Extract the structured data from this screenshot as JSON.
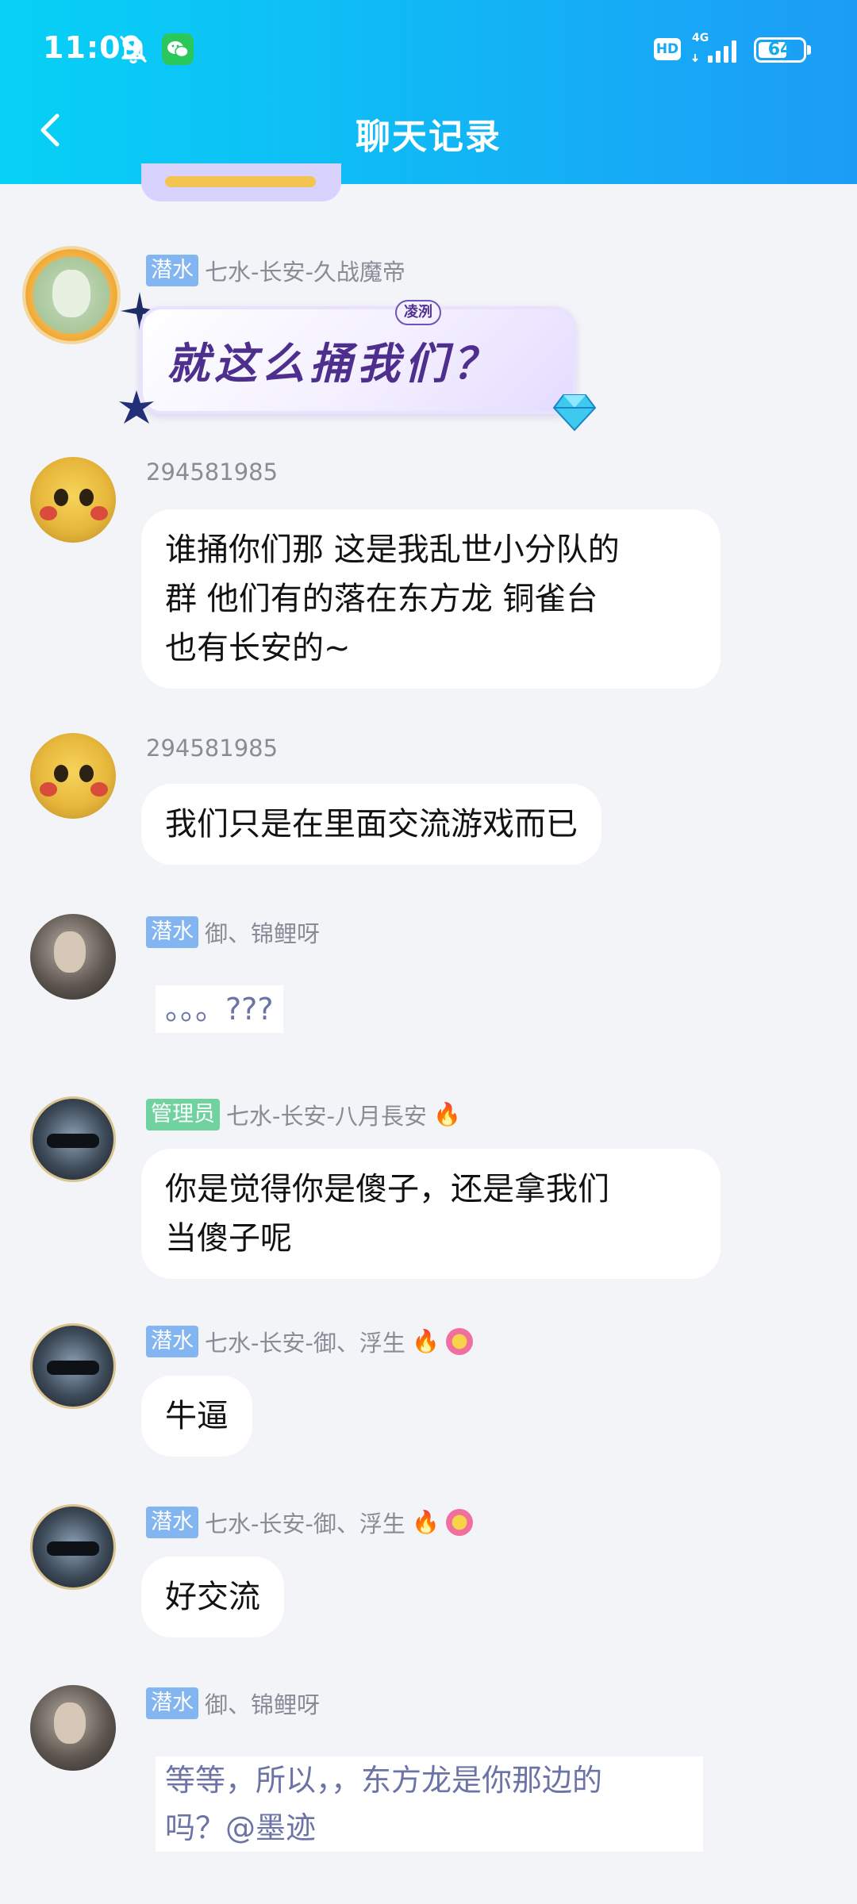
{
  "status_bar": {
    "time": "11:09",
    "network": "4G",
    "hd_label": "HD",
    "battery": "64",
    "battery_level": 0.64
  },
  "header": {
    "title": "聊天记录"
  },
  "messages": [
    {
      "badge": "潜水",
      "sender": "七水-长安-久战魔帝",
      "sticker_text": "就这么捅我们？",
      "sticker_tag": "凌洌"
    },
    {
      "sender": "294581985",
      "text": [
        "谁捅你们那 这是我乱世小分队的",
        "群 他们有的落在东方龙 铜雀台",
        "也有长安的~"
      ]
    },
    {
      "sender": "294581985",
      "text": [
        "我们只是在里面交流游戏而已"
      ]
    },
    {
      "badge": "潜水",
      "sender": "御、锦鲤呀",
      "text": [
        "。。。???"
      ]
    },
    {
      "badge": "管理员",
      "sender": "七水-长安-八月長安",
      "text": [
        "你是觉得你是傻子，还是拿我们",
        "当傻子呢"
      ]
    },
    {
      "badge": "潜水",
      "sender": "七水-长安-御、浮生",
      "text": [
        "牛逼"
      ]
    },
    {
      "badge": "潜水",
      "sender": "七水-长安-御、浮生",
      "text": [
        "好交流"
      ]
    },
    {
      "badge": "潜水",
      "sender": "御、锦鲤呀",
      "text": [
        "等等，所以，，东方龙是你那边的",
        "吗？@墨迹"
      ]
    }
  ],
  "colors": {
    "header_start": "#07d1f6",
    "header_end": "#1d9cf6",
    "badge_dive": "#83b5f0",
    "badge_admin": "#6fd29f",
    "background": "#f3f4f8"
  },
  "icons": {
    "back": "chevron-left-icon",
    "mute": "bell-off-icon",
    "app": "wechat-icon",
    "fire": "fire-icon",
    "flower": "flower-icon",
    "gem": "gem-icon"
  }
}
